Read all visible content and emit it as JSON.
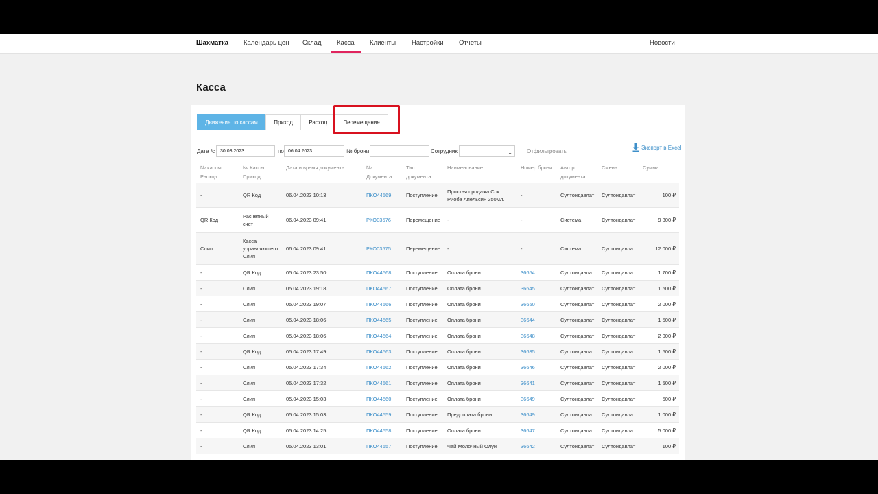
{
  "nav": {
    "items": [
      "Шахматка",
      "Календарь цен",
      "Склад",
      "Касса",
      "Клиенты",
      "Настройки",
      "Отчеты"
    ],
    "active_index": 3,
    "right": "Новости",
    "active_color": "#e0245e"
  },
  "page_title": "Касса",
  "tabs": [
    "Движение по кассам",
    "Приход",
    "Расход",
    "Перемещение"
  ],
  "active_tab_index": 0,
  "accent_color": "#5eb4e6",
  "highlight_color": "#d8111f",
  "filters": {
    "date_label": "Дата /с",
    "date_from": "30.03.2023",
    "to_label": "по",
    "date_to": "06.04.2023",
    "booking_label": "№ брони",
    "booking_value": "",
    "employee_label": "Сотрудник",
    "employee_value": "",
    "filter_button": "Отфильтровать",
    "export_label": "Экспорт в Excel"
  },
  "columns": [
    "№ кассы\nРасход",
    "№ Кассы\nПриход",
    "Дата и время документа",
    "№\nДокумента",
    "Тип\nдокумента",
    "Наименование",
    "Номер брони",
    "Автор\nдокумента",
    "Смена",
    "Сумма"
  ],
  "rows": [
    {
      "expense": "-",
      "income": "QR Код",
      "datetime": "06.04.2023 10:13",
      "doc": "ПКО44569",
      "type": "Поступление",
      "name": "Простая продажа Сок\nРиоба Апельсин 250мл.",
      "booking": "-",
      "author": "Султондавлат",
      "shift": "Султондавлат",
      "amount": "100 ₽"
    },
    {
      "expense": "QR Код",
      "income": "Расчетный\nсчет",
      "datetime": "06.04.2023 09:41",
      "doc": "РКО03576",
      "type": "Перемещение",
      "name": "-",
      "booking": "-",
      "author": "Система",
      "shift": "Султондавлат",
      "amount": "9 300 ₽"
    },
    {
      "expense": "Слип",
      "income": "Касса\nуправляющего\nСлип",
      "datetime": "06.04.2023 09:41",
      "doc": "РКО03575",
      "type": "Перемещение",
      "name": "-",
      "booking": "-",
      "author": "Система",
      "shift": "Султондавлат",
      "amount": "12 000 ₽"
    },
    {
      "expense": "-",
      "income": "QR Код",
      "datetime": "05.04.2023 23:50",
      "doc": "ПКО44568",
      "type": "Поступление",
      "name": "Оплата брони",
      "booking": "36654",
      "author": "Султондавлат",
      "shift": "Султондавлат",
      "amount": "1 700 ₽"
    },
    {
      "expense": "-",
      "income": "Слип",
      "datetime": "05.04.2023 19:18",
      "doc": "ПКО44567",
      "type": "Поступление",
      "name": "Оплата брони",
      "booking": "36645",
      "author": "Султондавлат",
      "shift": "Султондавлат",
      "amount": "1 500 ₽"
    },
    {
      "expense": "-",
      "income": "Слип",
      "datetime": "05.04.2023 19:07",
      "doc": "ПКО44566",
      "type": "Поступление",
      "name": "Оплата брони",
      "booking": "36650",
      "author": "Султондавлат",
      "shift": "Султондавлат",
      "amount": "2 000 ₽"
    },
    {
      "expense": "-",
      "income": "Слип",
      "datetime": "05.04.2023 18:06",
      "doc": "ПКО44565",
      "type": "Поступление",
      "name": "Оплата брони",
      "booking": "36644",
      "author": "Султондавлат",
      "shift": "Султондавлат",
      "amount": "1 500 ₽"
    },
    {
      "expense": "-",
      "income": "Слип",
      "datetime": "05.04.2023 18:06",
      "doc": "ПКО44564",
      "type": "Поступление",
      "name": "Оплата брони",
      "booking": "36648",
      "author": "Султондавлат",
      "shift": "Султондавлат",
      "amount": "2 000 ₽"
    },
    {
      "expense": "-",
      "income": "QR Код",
      "datetime": "05.04.2023 17:49",
      "doc": "ПКО44563",
      "type": "Поступление",
      "name": "Оплата брони",
      "booking": "36635",
      "author": "Султондавлат",
      "shift": "Султондавлат",
      "amount": "1 500 ₽"
    },
    {
      "expense": "-",
      "income": "Слип",
      "datetime": "05.04.2023 17:34",
      "doc": "ПКО44562",
      "type": "Поступление",
      "name": "Оплата брони",
      "booking": "36646",
      "author": "Султондавлат",
      "shift": "Султондавлат",
      "amount": "2 000 ₽"
    },
    {
      "expense": "-",
      "income": "Слип",
      "datetime": "05.04.2023 17:32",
      "doc": "ПКО44561",
      "type": "Поступление",
      "name": "Оплата брони",
      "booking": "36641",
      "author": "Султондавлат",
      "shift": "Султондавлат",
      "amount": "1 500 ₽"
    },
    {
      "expense": "-",
      "income": "Слип",
      "datetime": "05.04.2023 15:03",
      "doc": "ПКО44560",
      "type": "Поступление",
      "name": "Оплата брони",
      "booking": "36649",
      "author": "Султондавлат",
      "shift": "Султондавлат",
      "amount": "500 ₽"
    },
    {
      "expense": "-",
      "income": "QR Код",
      "datetime": "05.04.2023 15:03",
      "doc": "ПКО44559",
      "type": "Поступление",
      "name": "Предоплата брони",
      "booking": "36649",
      "author": "Султондавлат",
      "shift": "Султондавлат",
      "amount": "1 000 ₽"
    },
    {
      "expense": "-",
      "income": "QR Код",
      "datetime": "05.04.2023 14:25",
      "doc": "ПКО44558",
      "type": "Поступление",
      "name": "Оплата брони",
      "booking": "36647",
      "author": "Султондавлат",
      "shift": "Султондавлат",
      "amount": "5 000 ₽"
    },
    {
      "expense": "-",
      "income": "Слип",
      "datetime": "05.04.2023 13:01",
      "doc": "ПКО44557",
      "type": "Поступление",
      "name": "Чай Молочный Олун",
      "booking": "36642",
      "author": "Султондавлат",
      "shift": "Султондавлат",
      "amount": "100 ₽"
    }
  ]
}
